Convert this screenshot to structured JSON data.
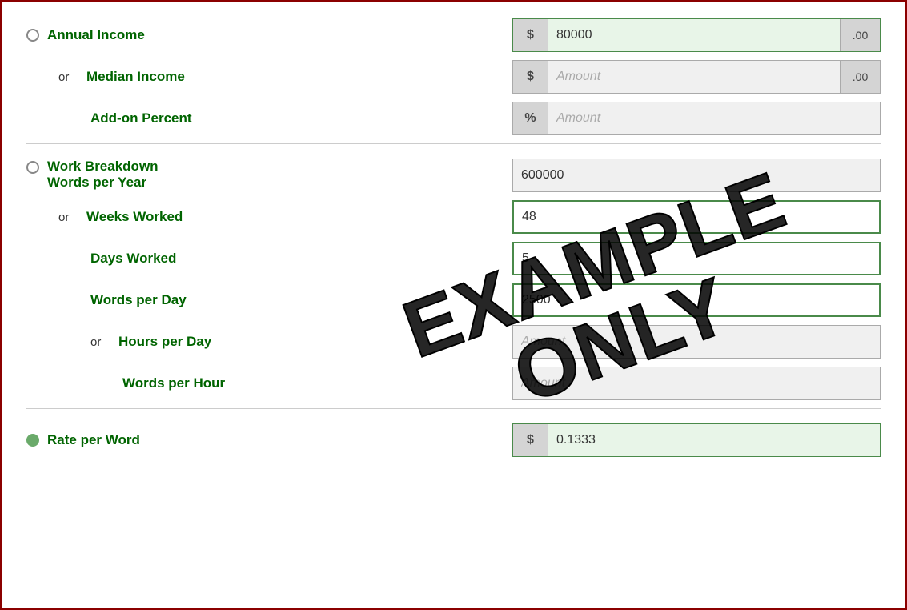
{
  "annual_income": {
    "label": "Annual Income",
    "prefix": "$",
    "value": "80000",
    "suffix": ".00",
    "selected": false
  },
  "median_income": {
    "or_text": "or",
    "label": "Median Income",
    "prefix": "$",
    "placeholder": "Amount",
    "suffix": ".00"
  },
  "addon_percent": {
    "label": "Add-on Percent",
    "prefix": "%",
    "placeholder": "Amount"
  },
  "work_breakdown": {
    "label_line1": "Work Breakdown",
    "label_line2": "Words per Year",
    "value": "600000",
    "selected": false
  },
  "weeks_worked": {
    "or_text": "or",
    "label": "Weeks Worked",
    "value": "48"
  },
  "days_worked": {
    "label": "Days Worked",
    "value": "5"
  },
  "words_per_day": {
    "label": "Words per Day",
    "value": "2500"
  },
  "hours_per_day": {
    "or_text": "or",
    "label": "Hours per Day",
    "placeholder": "Amount"
  },
  "words_per_hour": {
    "label": "Words per Hour",
    "placeholder": "Amount"
  },
  "rate_per_word": {
    "label": "Rate per Word",
    "prefix": "$",
    "value": "0.1333",
    "selected": true
  },
  "watermark": {
    "line1": "EXAMPLE",
    "line2": "ONLY"
  }
}
